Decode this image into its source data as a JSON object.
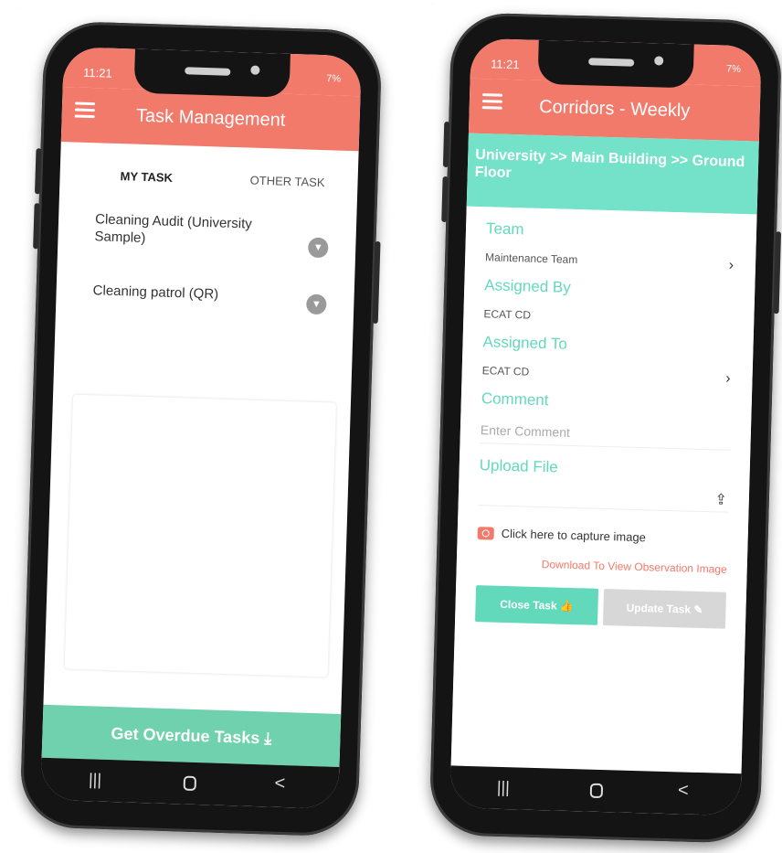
{
  "left_phone": {
    "status_time": "11:21",
    "status_right": "7%",
    "menu_icon": "hamburger-menu-icon",
    "title": "Task Management",
    "tabs": {
      "my_task": "MY TASK",
      "other_task": "OTHER TASK"
    },
    "tasks": [
      {
        "label": "Cleaning Audit (University Sample)"
      },
      {
        "label": "Cleaning patrol (QR)"
      }
    ],
    "bottom_action": "Get Overdue Tasks",
    "bottom_action_icon": "download-icon",
    "nav": {
      "recent": "|||",
      "home": "",
      "back": "<"
    }
  },
  "right_phone": {
    "status_time": "11:21",
    "status_right": "7%",
    "menu_icon": "hamburger-menu-icon",
    "title": "Corridors - Weekly",
    "breadcrumb": "University >> Main Building >> Ground Floor",
    "fields": {
      "team_label": "Team",
      "team_value": "Maintenance Team",
      "assigned_by_label": "Assigned By",
      "assigned_by_value": "ECAT CD",
      "assigned_to_label": "Assigned To",
      "assigned_to_value": "ECAT CD",
      "comment_label": "Comment",
      "comment_placeholder": "Enter Comment",
      "upload_label": "Upload File"
    },
    "capture_text": "Click here to capture image",
    "download_link": "Download To View Observation Image",
    "buttons": {
      "close": "Close Task",
      "update": "Update Task"
    },
    "nav": {
      "recent": "|||",
      "home": "",
      "back": "<"
    }
  },
  "colors": {
    "header": "#f27a6b",
    "accent": "#63d9bc",
    "breadcrumb_bg": "#74e2c8"
  }
}
